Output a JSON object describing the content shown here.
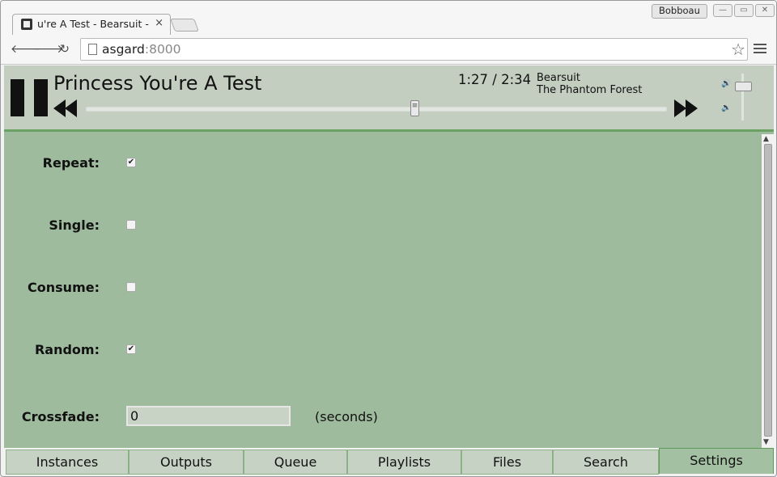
{
  "browser": {
    "tab_title": "u're A Test - Bearsuit - |",
    "tab_close": "×",
    "profile_name": "Bobboau",
    "window_buttons": [
      "—",
      "▭",
      "✕"
    ],
    "nav": {
      "back": "🡐",
      "forward": "🡒",
      "reload": "↻"
    },
    "url_host": "asgard",
    "url_port": ":8000",
    "star": "☆"
  },
  "player": {
    "title": "Princess You're A Test",
    "time": "1:27 / 2:34",
    "artist": "Bearsuit",
    "album": "The Phantom Forest",
    "progress_fraction": 0.566,
    "volume_fraction": 0.74,
    "vol_up_icon": "🔊",
    "vol_down_icon": "🔈"
  },
  "settings": {
    "repeat": {
      "label": "Repeat:",
      "checked": true
    },
    "single": {
      "label": "Single:",
      "checked": false
    },
    "consume": {
      "label": "Consume:",
      "checked": false
    },
    "random": {
      "label": "Random:",
      "checked": true
    },
    "crossfade": {
      "label": "Crossfade:",
      "value": "0",
      "unit": "(seconds)"
    }
  },
  "bottom_tabs": [
    "Instances",
    "Outputs",
    "Queue",
    "Playlists",
    "Files",
    "Search",
    "Settings"
  ],
  "active_tab": "Settings",
  "colors": {
    "accent": "#6aa264",
    "content_bg": "#9fbb9d",
    "header_bg": "#c3cec0"
  }
}
